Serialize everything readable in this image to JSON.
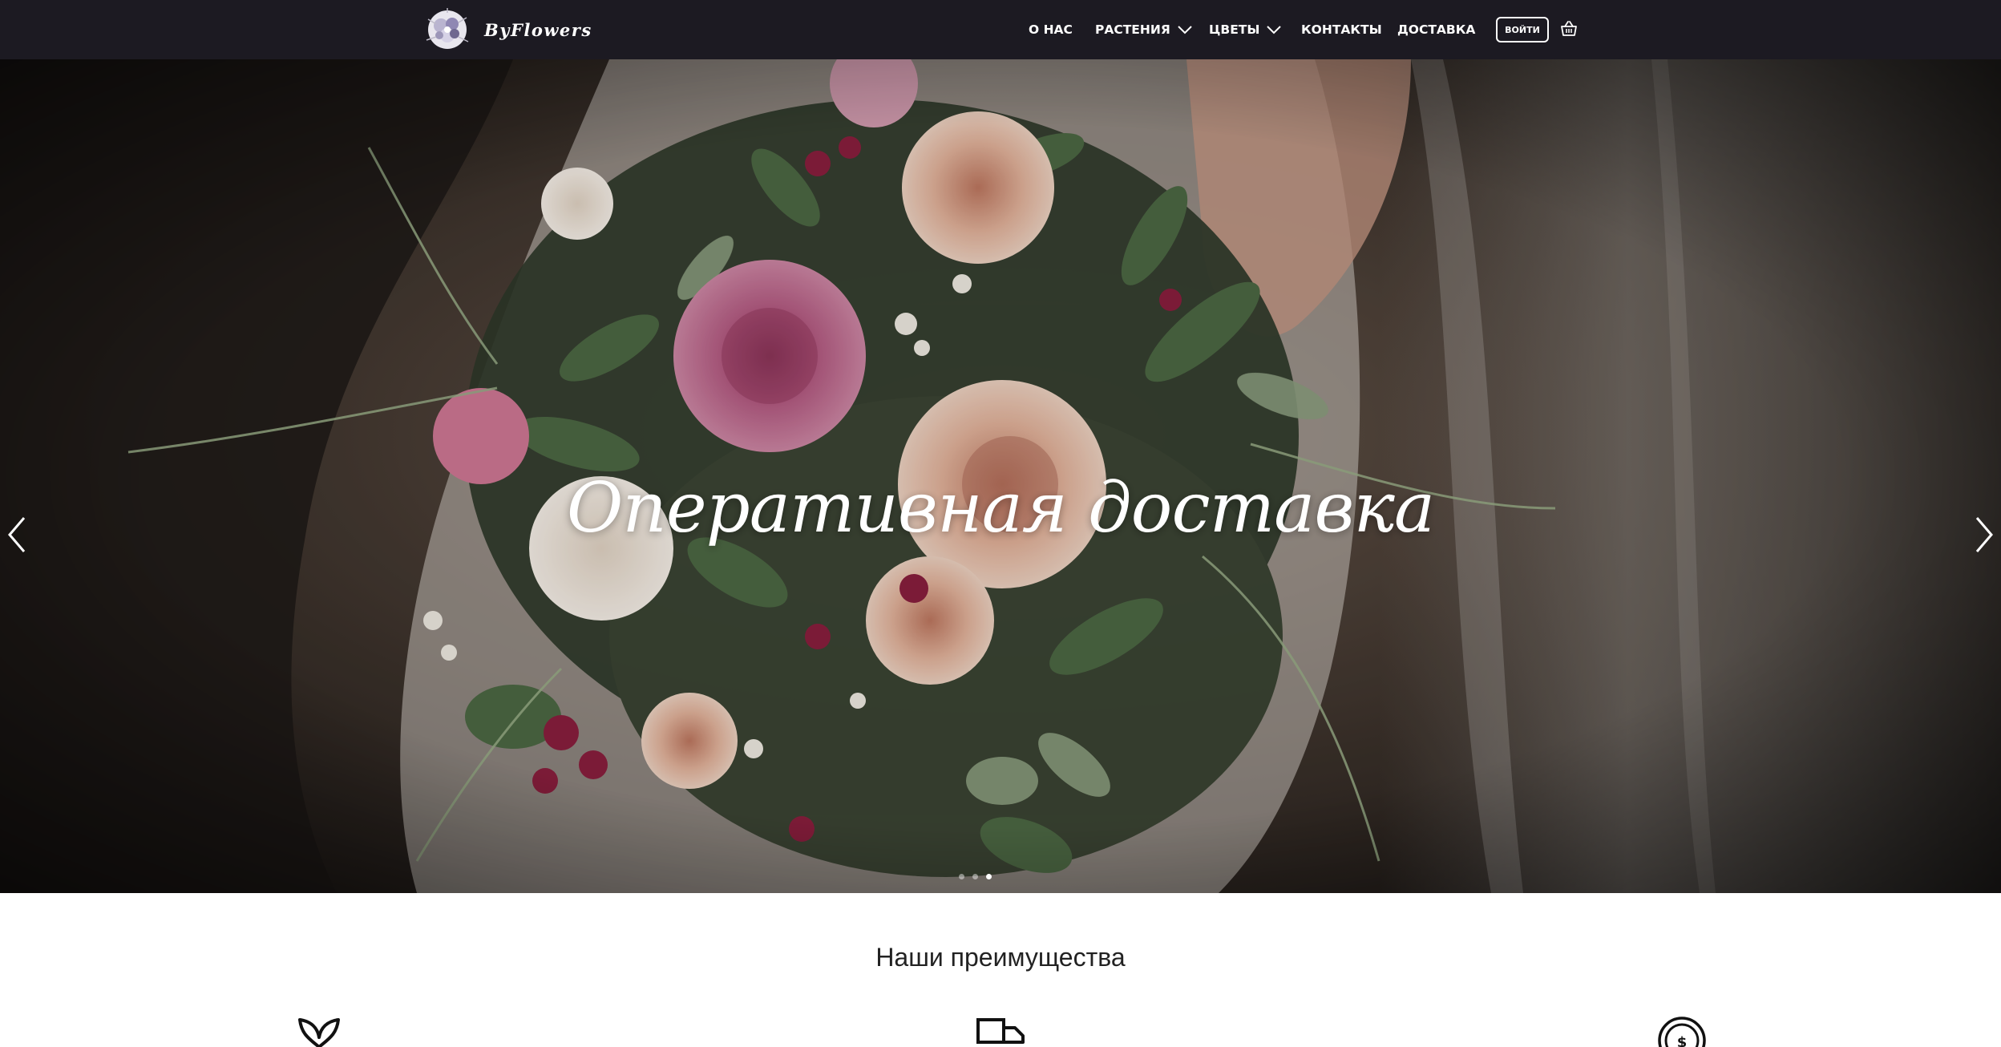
{
  "header": {
    "brand": "ByFlowers",
    "nav": [
      {
        "label": "О НАС",
        "dropdown": false
      },
      {
        "label": "РАСТЕНИЯ",
        "dropdown": true
      },
      {
        "label": "ЦВЕТЫ",
        "dropdown": true
      },
      {
        "label": "КОНТАКТЫ",
        "dropdown": false
      },
      {
        "label": "ДОСТАВКА",
        "dropdown": false
      }
    ],
    "login_label": "ВОЙТИ",
    "cart_icon": "basket-icon"
  },
  "hero": {
    "title": "Оперативная доставка",
    "prev_icon": "chevron-left-icon",
    "next_icon": "chevron-right-icon",
    "slide_count": 3,
    "active_slide": 3
  },
  "advantages": {
    "title": "Наши преимущества",
    "icons": [
      "leaf-icon",
      "truck-icon",
      "coin-icon"
    ]
  },
  "colors": {
    "header_bg": "#1c1a22",
    "text_light": "#ffffff",
    "text_dark": "#222222"
  }
}
